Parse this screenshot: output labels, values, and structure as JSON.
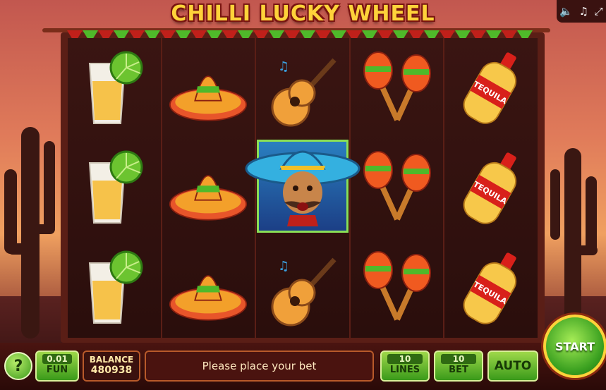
{
  "title": "CHILLI LUCKY WHEEL",
  "top_controls": [
    "speaker-icon",
    "music-icon",
    "fullscreen-icon"
  ],
  "reels": [
    [
      "tequila-shot",
      "tequila-shot",
      "tequila-shot"
    ],
    [
      "sombrero",
      "sombrero",
      "sombrero"
    ],
    [
      "guitar",
      "mariachi-wild",
      "guitar"
    ],
    [
      "maracas",
      "maracas",
      "maracas"
    ],
    [
      "tequila-bottle",
      "tequila-bottle",
      "tequila-bottle"
    ]
  ],
  "bottle_label": "TEQUILA",
  "bottom_bar": {
    "help_label": "?",
    "coin": {
      "value": "0.01",
      "label": "FUN"
    },
    "balance": {
      "label": "BALANCE",
      "value": "480938"
    },
    "message": "Please place your bet",
    "lines": {
      "value": "10",
      "label": "LINES"
    },
    "bet": {
      "value": "10",
      "label": "BET"
    },
    "auto_label": "AUTO",
    "start_label": "START"
  },
  "colors": {
    "gold": "#ffd23a",
    "green": "#3a9a1a",
    "red": "#c0201a",
    "panel": "#3a110e"
  }
}
